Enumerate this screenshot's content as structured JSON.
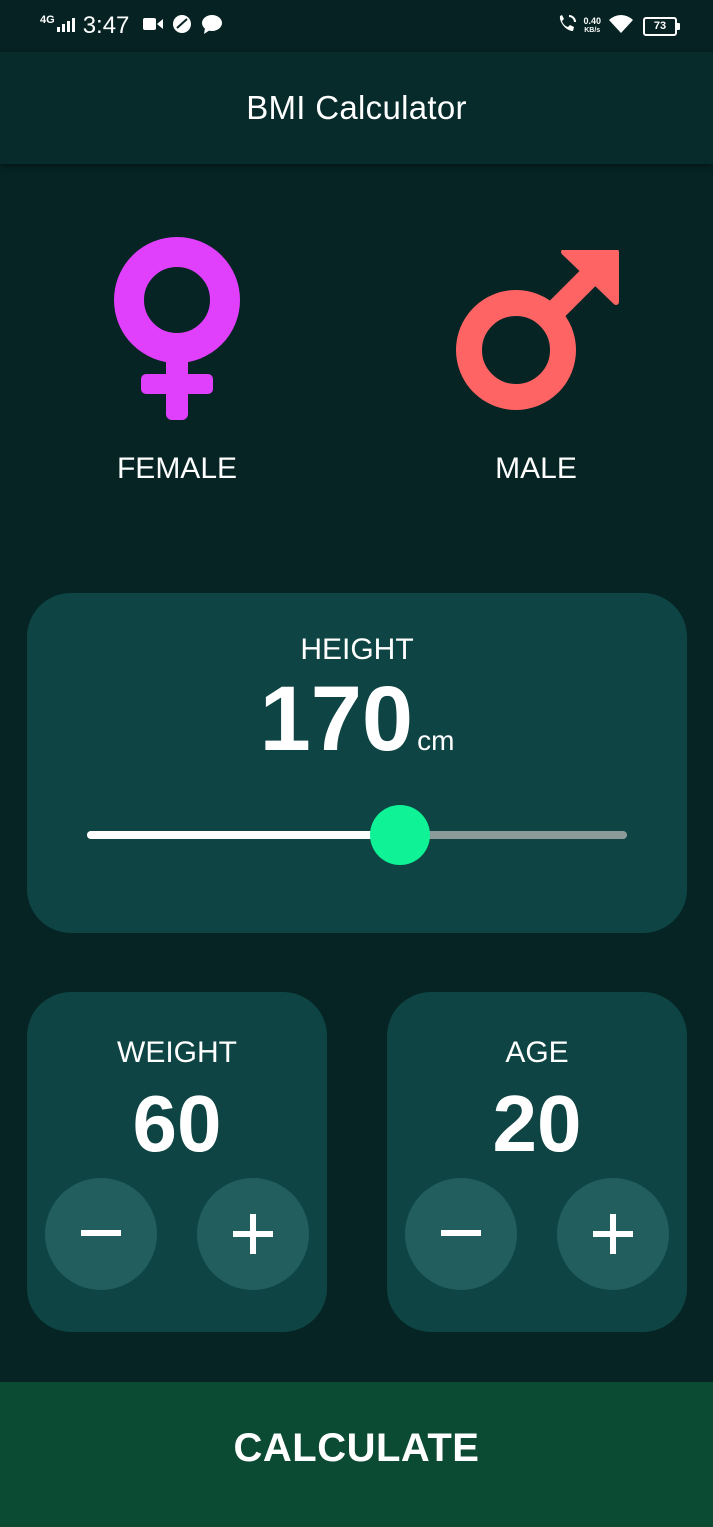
{
  "status_bar": {
    "network": "4G",
    "time": "3:47",
    "speed_value": "0.40",
    "speed_unit": "KB/s",
    "battery": "73"
  },
  "app_bar": {
    "title": "BMI Calculator"
  },
  "gender": {
    "female_label": "FEMALE",
    "male_label": "MALE",
    "female_color": "#e040fb",
    "male_color": "#ff6464"
  },
  "height": {
    "label": "HEIGHT",
    "value": "170",
    "unit": "cm",
    "slider_fraction": 0.58
  },
  "weight": {
    "label": "WEIGHT",
    "value": "60"
  },
  "age": {
    "label": "AGE",
    "value": "20"
  },
  "calculate_label": "CALCULATE",
  "colors": {
    "background": "#062424",
    "card": "#0e4544",
    "button": "#235e5e",
    "slider_thumb": "#0ff396",
    "calculate": "#0b4a33"
  }
}
